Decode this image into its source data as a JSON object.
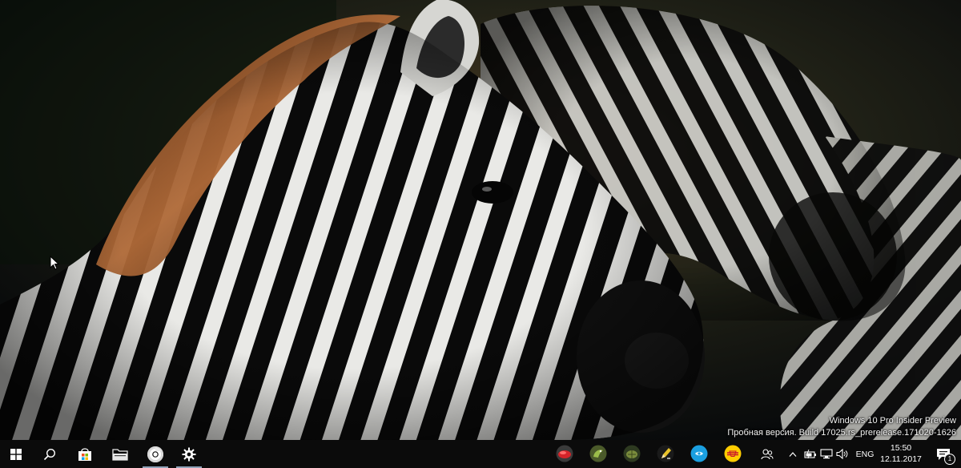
{
  "desktop": {
    "watermark": {
      "line1": "Windows 10 Pro Insider Preview",
      "line2": "Пробная версия. Build 17025.rs_prerelease.171020-1626"
    }
  },
  "taskbar": {
    "left_buttons": [
      {
        "icon": "windows-start-icon"
      },
      {
        "icon": "search-icon"
      },
      {
        "icon": "store-icon"
      },
      {
        "icon": "file-explorer-icon"
      },
      {
        "icon": "chrome-icon"
      },
      {
        "icon": "settings-icon"
      }
    ],
    "tray_apps": [
      {
        "icon": "red-car-app-icon"
      },
      {
        "icon": "green-bird-app-icon"
      },
      {
        "icon": "turtle-app-icon"
      },
      {
        "icon": "pencil-app-icon"
      },
      {
        "icon": "blue-circle-app-icon"
      },
      {
        "icon": "yellow-app-icon"
      }
    ],
    "tray_icons": [
      {
        "icon": "people-icon"
      },
      {
        "icon": "show-hidden-icons-chevron-icon"
      },
      {
        "icon": "battery-icon"
      },
      {
        "icon": "network-icon"
      },
      {
        "icon": "volume-icon"
      }
    ],
    "language": "ENG",
    "clock": {
      "time": "15:50",
      "date": "12.11.2017"
    },
    "notification_count": "1",
    "colors": {
      "background": "#0c0c0c",
      "running_indicator": "#8fa2b8"
    }
  }
}
